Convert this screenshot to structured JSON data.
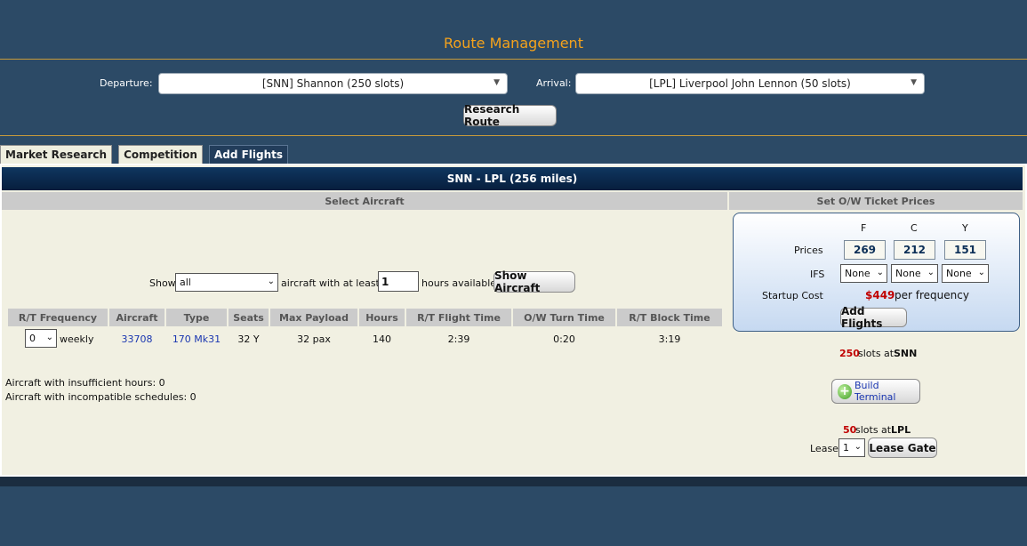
{
  "page": {
    "title": "Route Management"
  },
  "departure": {
    "label": "Departure:",
    "value": "[SNN] Shannon (250 slots)"
  },
  "arrival": {
    "label": "Arrival:",
    "value": "[LPL] Liverpool John Lennon (50 slots)"
  },
  "research_button": "Research Route",
  "tabs": [
    {
      "label": "Market Research",
      "active": false
    },
    {
      "label": "Competition",
      "active": false
    },
    {
      "label": "Add Flights",
      "active": true
    }
  ],
  "route_header": "SNN - LPL (256 miles)",
  "select_aircraft": {
    "heading": "Select Aircraft",
    "show_label": "Show",
    "show_value": "all",
    "at_least_label": "aircraft with at least",
    "hours_value": "1",
    "hours_label": "hours available:",
    "show_button": "Show Aircraft"
  },
  "table": {
    "columns": [
      "R/T Frequency",
      "Aircraft",
      "Type",
      "Seats",
      "Max Payload",
      "Hours",
      "R/T Flight Time",
      "O/W Turn Time",
      "R/T Block Time"
    ],
    "row": {
      "frequency": "0",
      "frequency_unit": "weekly",
      "aircraft": "33708",
      "type": "170 Mk31",
      "seats": "32 Y",
      "max_payload": "32 pax",
      "hours": "140",
      "rt_flight_time": "2:39",
      "ow_turn_time": "0:20",
      "rt_block_time": "3:19"
    }
  },
  "notes": {
    "insufficient": "Aircraft with insufficient hours: 0",
    "incompatible": "Aircraft with incompatible schedules: 0"
  },
  "ticket_prices": {
    "heading": "Set O/W Ticket Prices",
    "classes": [
      "F",
      "C",
      "Y"
    ],
    "prices_label": "Prices",
    "prices": [
      "269",
      "212",
      "151"
    ],
    "ifs_label": "IFS",
    "ifs": [
      "None",
      "None",
      "None"
    ],
    "startup_label": "Startup Cost",
    "startup_value": "$449",
    "startup_suffix": "per frequency",
    "add_button": "Add Flights"
  },
  "slots": {
    "snn_count": "250",
    "snn_text": "slots at",
    "snn_code": "SNN",
    "build_terminal": "Build Terminal",
    "lpl_count": "50",
    "lpl_text": "slots at",
    "lpl_code": "LPL",
    "lease_label": "Lease",
    "lease_value": "1",
    "lease_button": "Lease Gate"
  },
  "colors": {
    "accent": "#f4a21c",
    "background": "#2c4a66",
    "panel": "#f1f0e2",
    "header": "#0f3660",
    "red": "#c00000",
    "link": "#1a36b0"
  }
}
